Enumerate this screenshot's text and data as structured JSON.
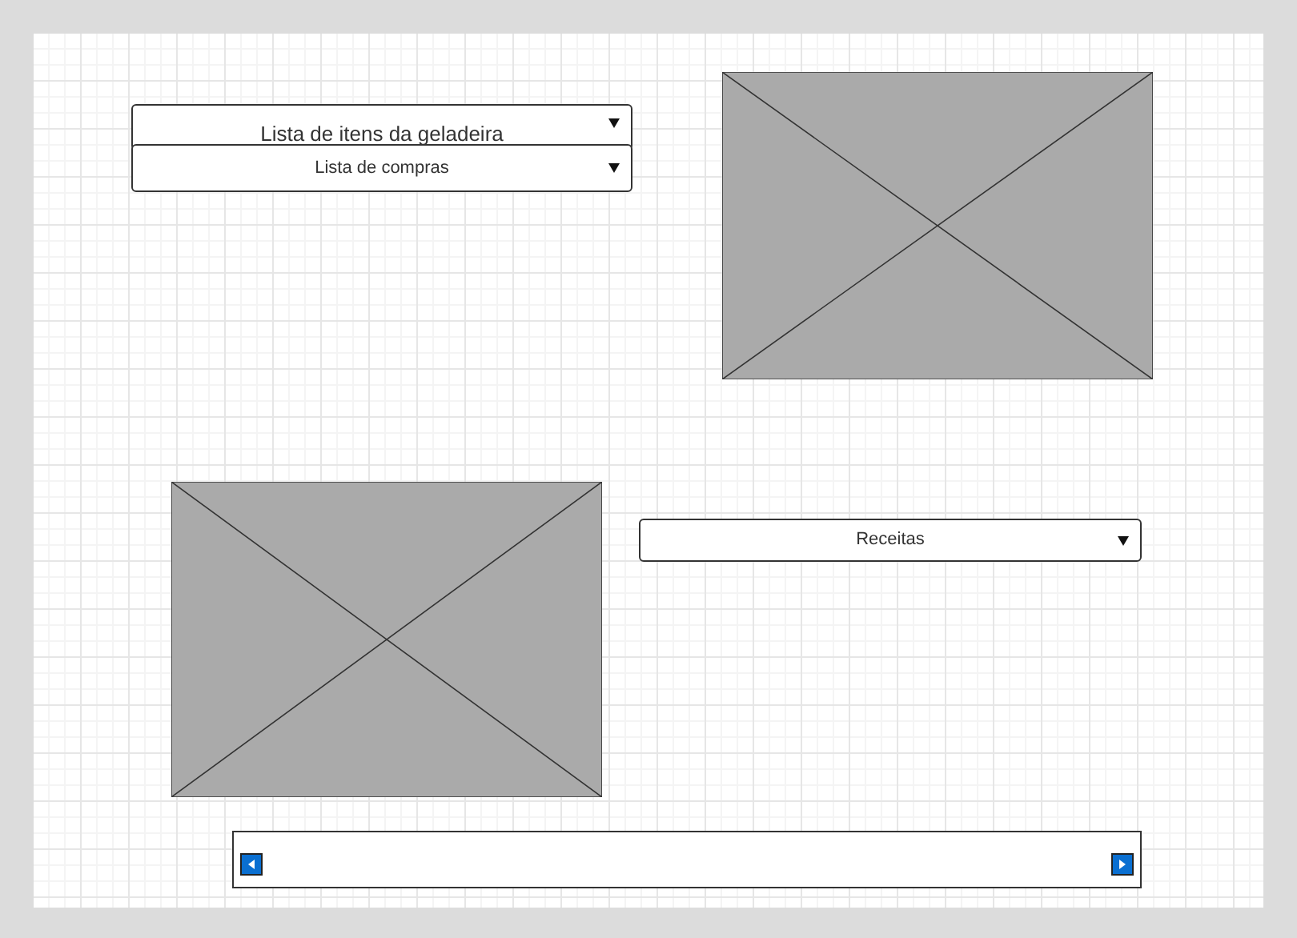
{
  "dropdowns": [
    {
      "value": "Lista de itens da geladeira",
      "kind": "large"
    },
    {
      "value": "Lista de compras",
      "kind": "small"
    },
    {
      "value": "Receitas",
      "kind": "small"
    }
  ],
  "image_placeholders": [
    {
      "kind": "placeholder"
    },
    {
      "kind": "placeholder"
    }
  ],
  "carousel": {
    "kind": "horizontal-scroller"
  }
}
